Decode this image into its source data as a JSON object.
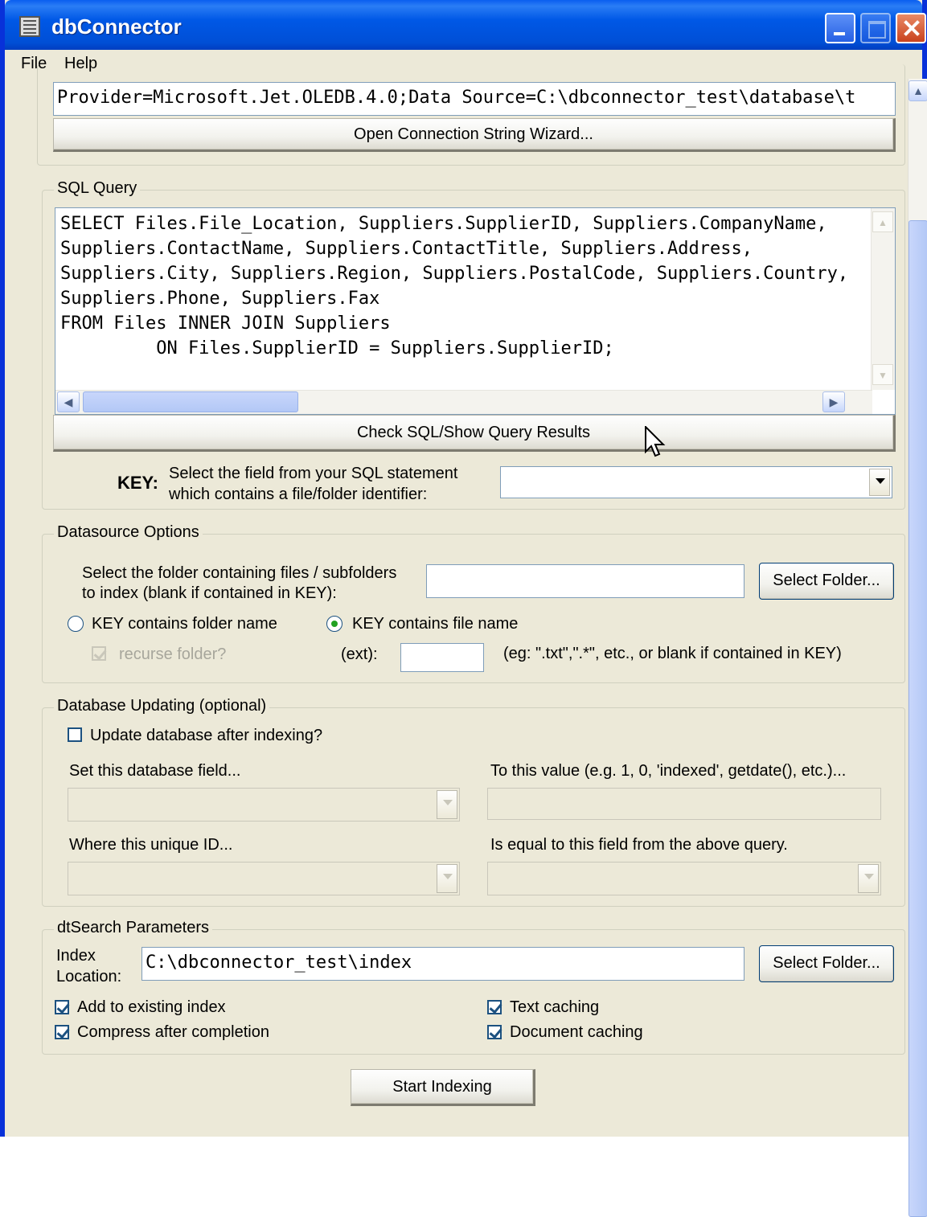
{
  "window": {
    "title": "dbConnector"
  },
  "menu": {
    "file": "File",
    "help": "Help"
  },
  "connection": {
    "string_value": "Provider=Microsoft.Jet.OLEDB.4.0;Data Source=C:\\dbconnector_test\\database\\t",
    "wizard_button": "Open Connection String Wizard..."
  },
  "sql": {
    "legend": "SQL Query",
    "query": "SELECT Files.File_Location, Suppliers.SupplierID, Suppliers.CompanyName,\nSuppliers.ContactName, Suppliers.ContactTitle, Suppliers.Address,\nSuppliers.City, Suppliers.Region, Suppliers.PostalCode, Suppliers.Country,\nSuppliers.Phone, Suppliers.Fax\nFROM Files INNER JOIN Suppliers\n         ON Files.SupplierID = Suppliers.SupplierID;",
    "check_button": "Check SQL/Show Query Results",
    "key_label": "KEY:",
    "key_desc_1": "Select the field from your SQL statement",
    "key_desc_2": "which contains a file/folder identifier:",
    "key_value": ""
  },
  "datasource": {
    "legend": "Datasource Options",
    "folder_label_1": "Select the folder containing files / subfolders",
    "folder_label_2": "to index (blank if contained in KEY):",
    "folder_value": "",
    "select_folder_button": "Select Folder...",
    "radio_folder": "KEY contains folder name",
    "radio_file": "KEY contains file name",
    "recurse_label": "recurse folder?",
    "ext_label": "(ext):",
    "ext_value": "",
    "ext_hint": "(eg: \".txt\",\".*\", etc., or blank if contained in KEY)"
  },
  "db_update": {
    "legend": "Database Updating (optional)",
    "update_checkbox": "Update database after indexing?",
    "set_field_label": "Set this database field...",
    "to_value_label": "To this value (e.g. 1, 0, 'indexed', getdate(), etc.)...",
    "where_label": "Where this unique ID...",
    "equal_label": "Is equal to this field from the above query."
  },
  "dtsearch": {
    "legend": "dtSearch Parameters",
    "index_label_1": "Index",
    "index_label_2": "Location:",
    "index_value": "C:\\dbconnector_test\\index",
    "select_folder_button": "Select Folder...",
    "add_existing": "Add to existing index",
    "compress": "Compress after completion",
    "text_caching": "Text caching",
    "doc_caching": "Document caching"
  },
  "start_button": "Start Indexing"
}
